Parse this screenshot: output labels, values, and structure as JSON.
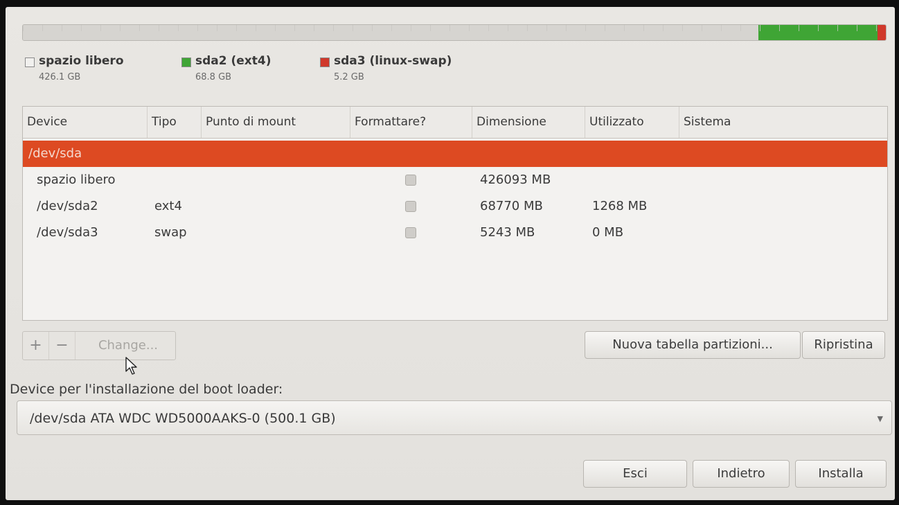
{
  "colors": {
    "free": "#f1f0ee",
    "ext4": "#3fa535",
    "swap": "#d0392b",
    "selected_row": "#dd4a22"
  },
  "partition_bar": {
    "segments": [
      {
        "name": "spazio libero",
        "fraction": 0.852,
        "color": "#d6d4d0"
      },
      {
        "name": "sda2 (ext4)",
        "fraction": 0.138,
        "color": "#3fa535"
      },
      {
        "name": "sda3 (linux-swap)",
        "fraction": 0.01,
        "color": "#d0392b"
      }
    ]
  },
  "legend": [
    {
      "name": "spazio libero",
      "size": "426.1 GB",
      "color": "#f1f0ee"
    },
    {
      "name": "sda2 (ext4)",
      "size": "68.8 GB",
      "color": "#3fa535"
    },
    {
      "name": "sda3 (linux-swap)",
      "size": "5.2 GB",
      "color": "#d0392b"
    }
  ],
  "table": {
    "columns": [
      "Device",
      "Tipo",
      "Punto di mount",
      "Formattare?",
      "Dimensione",
      "Utilizzato",
      "Sistema"
    ],
    "rows": [
      {
        "device": "/dev/sda",
        "tipo": "",
        "mount": "",
        "format": null,
        "size": "",
        "used": "",
        "system": ""
      },
      {
        "device": "spazio libero",
        "tipo": "",
        "mount": "",
        "format": false,
        "size": "426093 MB",
        "used": "",
        "system": ""
      },
      {
        "device": "/dev/sda2",
        "tipo": "ext4",
        "mount": "",
        "format": false,
        "size": "68770 MB",
        "used": "1268 MB",
        "system": ""
      },
      {
        "device": "/dev/sda3",
        "tipo": "swap",
        "mount": "",
        "format": false,
        "size": "5243 MB",
        "used": "0 MB",
        "system": ""
      }
    ]
  },
  "toolbar": {
    "add_label": "+",
    "remove_label": "−",
    "change_label": "Change...",
    "new_table_label": "Nuova tabella partizioni...",
    "revert_label": "Ripristina"
  },
  "boot": {
    "label": "Device per l'installazione del boot loader:",
    "value": "/dev/sda   ATA WDC WD5000AAKS-0 (500.1 GB)"
  },
  "footer": {
    "quit_label": "Esci",
    "back_label": "Indietro",
    "install_label": "Installa"
  },
  "icons": {
    "cursor": "pointer-arrow-icon",
    "dropdown": "chevron-down-icon"
  }
}
